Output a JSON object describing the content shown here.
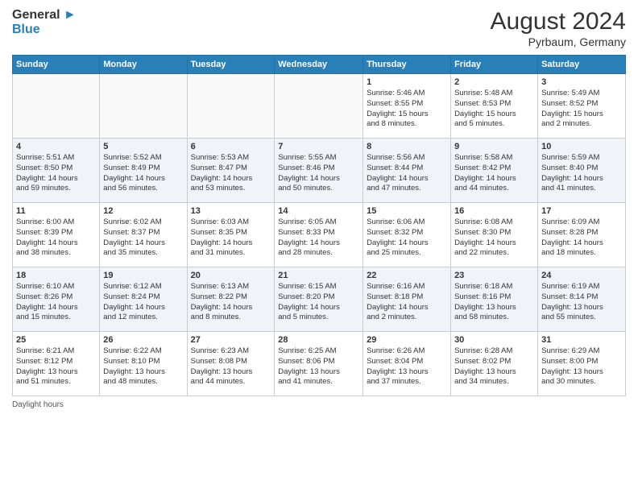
{
  "header": {
    "logo_line1": "General",
    "logo_line2": "Blue",
    "month": "August 2024",
    "location": "Pyrbaum, Germany"
  },
  "days_of_week": [
    "Sunday",
    "Monday",
    "Tuesday",
    "Wednesday",
    "Thursday",
    "Friday",
    "Saturday"
  ],
  "weeks": [
    [
      {
        "day": "",
        "detail": ""
      },
      {
        "day": "",
        "detail": ""
      },
      {
        "day": "",
        "detail": ""
      },
      {
        "day": "",
        "detail": ""
      },
      {
        "day": "1",
        "detail": "Sunrise: 5:46 AM\nSunset: 8:55 PM\nDaylight: 15 hours\nand 8 minutes."
      },
      {
        "day": "2",
        "detail": "Sunrise: 5:48 AM\nSunset: 8:53 PM\nDaylight: 15 hours\nand 5 minutes."
      },
      {
        "day": "3",
        "detail": "Sunrise: 5:49 AM\nSunset: 8:52 PM\nDaylight: 15 hours\nand 2 minutes."
      }
    ],
    [
      {
        "day": "4",
        "detail": "Sunrise: 5:51 AM\nSunset: 8:50 PM\nDaylight: 14 hours\nand 59 minutes."
      },
      {
        "day": "5",
        "detail": "Sunrise: 5:52 AM\nSunset: 8:49 PM\nDaylight: 14 hours\nand 56 minutes."
      },
      {
        "day": "6",
        "detail": "Sunrise: 5:53 AM\nSunset: 8:47 PM\nDaylight: 14 hours\nand 53 minutes."
      },
      {
        "day": "7",
        "detail": "Sunrise: 5:55 AM\nSunset: 8:46 PM\nDaylight: 14 hours\nand 50 minutes."
      },
      {
        "day": "8",
        "detail": "Sunrise: 5:56 AM\nSunset: 8:44 PM\nDaylight: 14 hours\nand 47 minutes."
      },
      {
        "day": "9",
        "detail": "Sunrise: 5:58 AM\nSunset: 8:42 PM\nDaylight: 14 hours\nand 44 minutes."
      },
      {
        "day": "10",
        "detail": "Sunrise: 5:59 AM\nSunset: 8:40 PM\nDaylight: 14 hours\nand 41 minutes."
      }
    ],
    [
      {
        "day": "11",
        "detail": "Sunrise: 6:00 AM\nSunset: 8:39 PM\nDaylight: 14 hours\nand 38 minutes."
      },
      {
        "day": "12",
        "detail": "Sunrise: 6:02 AM\nSunset: 8:37 PM\nDaylight: 14 hours\nand 35 minutes."
      },
      {
        "day": "13",
        "detail": "Sunrise: 6:03 AM\nSunset: 8:35 PM\nDaylight: 14 hours\nand 31 minutes."
      },
      {
        "day": "14",
        "detail": "Sunrise: 6:05 AM\nSunset: 8:33 PM\nDaylight: 14 hours\nand 28 minutes."
      },
      {
        "day": "15",
        "detail": "Sunrise: 6:06 AM\nSunset: 8:32 PM\nDaylight: 14 hours\nand 25 minutes."
      },
      {
        "day": "16",
        "detail": "Sunrise: 6:08 AM\nSunset: 8:30 PM\nDaylight: 14 hours\nand 22 minutes."
      },
      {
        "day": "17",
        "detail": "Sunrise: 6:09 AM\nSunset: 8:28 PM\nDaylight: 14 hours\nand 18 minutes."
      }
    ],
    [
      {
        "day": "18",
        "detail": "Sunrise: 6:10 AM\nSunset: 8:26 PM\nDaylight: 14 hours\nand 15 minutes."
      },
      {
        "day": "19",
        "detail": "Sunrise: 6:12 AM\nSunset: 8:24 PM\nDaylight: 14 hours\nand 12 minutes."
      },
      {
        "day": "20",
        "detail": "Sunrise: 6:13 AM\nSunset: 8:22 PM\nDaylight: 14 hours\nand 8 minutes."
      },
      {
        "day": "21",
        "detail": "Sunrise: 6:15 AM\nSunset: 8:20 PM\nDaylight: 14 hours\nand 5 minutes."
      },
      {
        "day": "22",
        "detail": "Sunrise: 6:16 AM\nSunset: 8:18 PM\nDaylight: 14 hours\nand 2 minutes."
      },
      {
        "day": "23",
        "detail": "Sunrise: 6:18 AM\nSunset: 8:16 PM\nDaylight: 13 hours\nand 58 minutes."
      },
      {
        "day": "24",
        "detail": "Sunrise: 6:19 AM\nSunset: 8:14 PM\nDaylight: 13 hours\nand 55 minutes."
      }
    ],
    [
      {
        "day": "25",
        "detail": "Sunrise: 6:21 AM\nSunset: 8:12 PM\nDaylight: 13 hours\nand 51 minutes."
      },
      {
        "day": "26",
        "detail": "Sunrise: 6:22 AM\nSunset: 8:10 PM\nDaylight: 13 hours\nand 48 minutes."
      },
      {
        "day": "27",
        "detail": "Sunrise: 6:23 AM\nSunset: 8:08 PM\nDaylight: 13 hours\nand 44 minutes."
      },
      {
        "day": "28",
        "detail": "Sunrise: 6:25 AM\nSunset: 8:06 PM\nDaylight: 13 hours\nand 41 minutes."
      },
      {
        "day": "29",
        "detail": "Sunrise: 6:26 AM\nSunset: 8:04 PM\nDaylight: 13 hours\nand 37 minutes."
      },
      {
        "day": "30",
        "detail": "Sunrise: 6:28 AM\nSunset: 8:02 PM\nDaylight: 13 hours\nand 34 minutes."
      },
      {
        "day": "31",
        "detail": "Sunrise: 6:29 AM\nSunset: 8:00 PM\nDaylight: 13 hours\nand 30 minutes."
      }
    ]
  ],
  "footer": {
    "daylight_label": "Daylight hours"
  }
}
